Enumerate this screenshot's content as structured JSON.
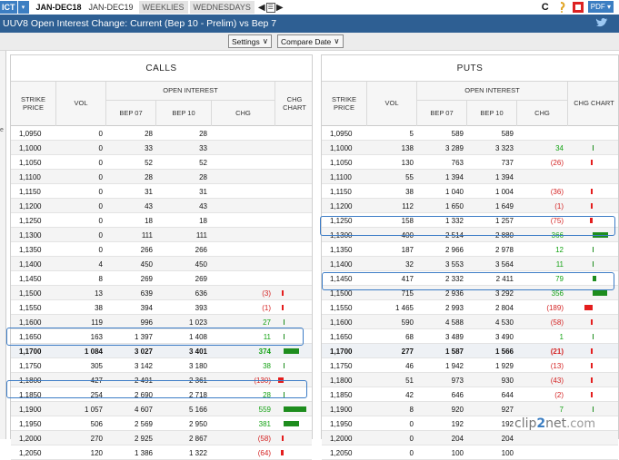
{
  "topbar": {
    "prefix": "ICT",
    "dropdown_arrow": "▾",
    "tabs": [
      "JAN-DEC18",
      "JAN-DEC19",
      "WEEKLIES",
      "WEDNESDAYS"
    ],
    "nav_prev": "◀",
    "nav_menu": "☰",
    "nav_next": "▶",
    "refresh": "C",
    "pdf": "PDF ▾"
  },
  "title": "UUV8 Open Interest Change: Current (Bep 10 - Prelim) vs Bep 7",
  "controls": {
    "settings": "Settings",
    "compare": "Compare Date",
    "caret": "∨"
  },
  "headers": {
    "strike": "STRIKE PRICE",
    "vol": "VOL",
    "open_interest": "OPEN INTEREST",
    "bep07": "BEP 07",
    "bep10": "BEP 10",
    "chg": "CHG",
    "chg_chart": "CHG CHART"
  },
  "calls": {
    "title": "CALLS",
    "rows": [
      {
        "strike": "1,0950",
        "vol": "0",
        "bep07": "28",
        "bep10": "28",
        "chg": "",
        "bar": 0
      },
      {
        "strike": "1,1000",
        "vol": "0",
        "bep07": "33",
        "bep10": "33",
        "chg": "",
        "bar": 0
      },
      {
        "strike": "1,1050",
        "vol": "0",
        "bep07": "52",
        "bep10": "52",
        "chg": "",
        "bar": 0
      },
      {
        "strike": "1,1100",
        "vol": "0",
        "bep07": "28",
        "bep10": "28",
        "chg": "",
        "bar": 0
      },
      {
        "strike": "1,1150",
        "vol": "0",
        "bep07": "31",
        "bep10": "31",
        "chg": "",
        "bar": 0
      },
      {
        "strike": "1,1200",
        "vol": "0",
        "bep07": "43",
        "bep10": "43",
        "chg": "",
        "bar": 0
      },
      {
        "strike": "1,1250",
        "vol": "0",
        "bep07": "18",
        "bep10": "18",
        "chg": "",
        "bar": 0
      },
      {
        "strike": "1,1300",
        "vol": "0",
        "bep07": "111",
        "bep10": "111",
        "chg": "",
        "bar": 0
      },
      {
        "strike": "1,1350",
        "vol": "0",
        "bep07": "266",
        "bep10": "266",
        "chg": "",
        "bar": 0
      },
      {
        "strike": "1,1400",
        "vol": "4",
        "bep07": "450",
        "bep10": "450",
        "chg": "",
        "bar": 0
      },
      {
        "strike": "1,1450",
        "vol": "8",
        "bep07": "269",
        "bep10": "269",
        "chg": "",
        "bar": 0
      },
      {
        "strike": "1,1500",
        "vol": "13",
        "bep07": "639",
        "bep10": "636",
        "chg": "(3)",
        "bar": -3
      },
      {
        "strike": "1,1550",
        "vol": "38",
        "bep07": "394",
        "bep10": "393",
        "chg": "(1)",
        "bar": -1
      },
      {
        "strike": "1,1600",
        "vol": "119",
        "bep07": "996",
        "bep10": "1 023",
        "chg": "27",
        "bar": 27
      },
      {
        "strike": "1,1650",
        "vol": "163",
        "bep07": "1 397",
        "bep10": "1 408",
        "chg": "11",
        "bar": 11
      },
      {
        "strike": "1,1700",
        "vol": "1 084",
        "bep07": "3 027",
        "bep10": "3 401",
        "chg": "374",
        "bar": 374,
        "bold": true
      },
      {
        "strike": "1,1750",
        "vol": "305",
        "bep07": "3 142",
        "bep10": "3 180",
        "chg": "38",
        "bar": 38
      },
      {
        "strike": "1,1800",
        "vol": "427",
        "bep07": "2 491",
        "bep10": "2 361",
        "chg": "(130)",
        "bar": -130
      },
      {
        "strike": "1,1850",
        "vol": "254",
        "bep07": "2 690",
        "bep10": "2 718",
        "chg": "28",
        "bar": 28
      },
      {
        "strike": "1,1900",
        "vol": "1 057",
        "bep07": "4 607",
        "bep10": "5 166",
        "chg": "559",
        "bar": 559
      },
      {
        "strike": "1,1950",
        "vol": "506",
        "bep07": "2 569",
        "bep10": "2 950",
        "chg": "381",
        "bar": 381
      },
      {
        "strike": "1,2000",
        "vol": "270",
        "bep07": "2 925",
        "bep10": "2 867",
        "chg": "(58)",
        "bar": -58
      },
      {
        "strike": "1,2050",
        "vol": "120",
        "bep07": "1 386",
        "bep10": "1 322",
        "chg": "(64)",
        "bar": -64
      }
    ]
  },
  "puts": {
    "title": "PUTS",
    "rows": [
      {
        "strike": "1,0950",
        "vol": "5",
        "bep07": "589",
        "bep10": "589",
        "chg": "",
        "bar": 0
      },
      {
        "strike": "1,1000",
        "vol": "138",
        "bep07": "3 289",
        "bep10": "3 323",
        "chg": "34",
        "bar": 34
      },
      {
        "strike": "1,1050",
        "vol": "130",
        "bep07": "763",
        "bep10": "737",
        "chg": "(26)",
        "bar": -26
      },
      {
        "strike": "1,1100",
        "vol": "55",
        "bep07": "1 394",
        "bep10": "1 394",
        "chg": "",
        "bar": 0
      },
      {
        "strike": "1,1150",
        "vol": "38",
        "bep07": "1 040",
        "bep10": "1 004",
        "chg": "(36)",
        "bar": -36
      },
      {
        "strike": "1,1200",
        "vol": "112",
        "bep07": "1 650",
        "bep10": "1 649",
        "chg": "(1)",
        "bar": -1
      },
      {
        "strike": "1,1250",
        "vol": "158",
        "bep07": "1 332",
        "bep10": "1 257",
        "chg": "(75)",
        "bar": -75
      },
      {
        "strike": "1,1300",
        "vol": "400",
        "bep07": "2 514",
        "bep10": "2 880",
        "chg": "366",
        "bar": 366
      },
      {
        "strike": "1,1350",
        "vol": "187",
        "bep07": "2 966",
        "bep10": "2 978",
        "chg": "12",
        "bar": 12
      },
      {
        "strike": "1,1400",
        "vol": "32",
        "bep07": "3 553",
        "bep10": "3 564",
        "chg": "11",
        "bar": 11
      },
      {
        "strike": "1,1450",
        "vol": "417",
        "bep07": "2 332",
        "bep10": "2 411",
        "chg": "79",
        "bar": 79
      },
      {
        "strike": "1,1500",
        "vol": "715",
        "bep07": "2 936",
        "bep10": "3 292",
        "chg": "356",
        "bar": 356
      },
      {
        "strike": "1,1550",
        "vol": "1 465",
        "bep07": "2 993",
        "bep10": "2 804",
        "chg": "(189)",
        "bar": -189
      },
      {
        "strike": "1,1600",
        "vol": "590",
        "bep07": "4 588",
        "bep10": "4 530",
        "chg": "(58)",
        "bar": -58
      },
      {
        "strike": "1,1650",
        "vol": "68",
        "bep07": "3 489",
        "bep10": "3 490",
        "chg": "1",
        "bar": 1
      },
      {
        "strike": "1,1700",
        "vol": "277",
        "bep07": "1 587",
        "bep10": "1 566",
        "chg": "(21)",
        "bar": -21,
        "bold": true
      },
      {
        "strike": "1,1750",
        "vol": "46",
        "bep07": "1 942",
        "bep10": "1 929",
        "chg": "(13)",
        "bar": -13
      },
      {
        "strike": "1,1800",
        "vol": "51",
        "bep07": "973",
        "bep10": "930",
        "chg": "(43)",
        "bar": -43
      },
      {
        "strike": "1,1850",
        "vol": "42",
        "bep07": "646",
        "bep10": "644",
        "chg": "(2)",
        "bar": -2
      },
      {
        "strike": "1,1900",
        "vol": "8",
        "bep07": "920",
        "bep10": "927",
        "chg": "7",
        "bar": 7
      },
      {
        "strike": "1,1950",
        "vol": "0",
        "bep07": "192",
        "bep10": "192",
        "chg": "",
        "bar": 0
      },
      {
        "strike": "1,2000",
        "vol": "0",
        "bep07": "204",
        "bep10": "204",
        "chg": "",
        "bar": 0
      },
      {
        "strike": "1,2050",
        "vol": "0",
        "bep07": "100",
        "bep10": "100",
        "chg": "",
        "bar": 0
      }
    ]
  },
  "watermark": {
    "a": "clip",
    "b": "2",
    "c": "net",
    "d": ".com"
  },
  "colors": {
    "positive": "#14a214",
    "negative": "#d42323",
    "bar_positive": "#1e8d1e",
    "bar_negative": "#e41e1e",
    "title_bar": "#2e5f93",
    "highlight_box": "#3c7cc6"
  }
}
